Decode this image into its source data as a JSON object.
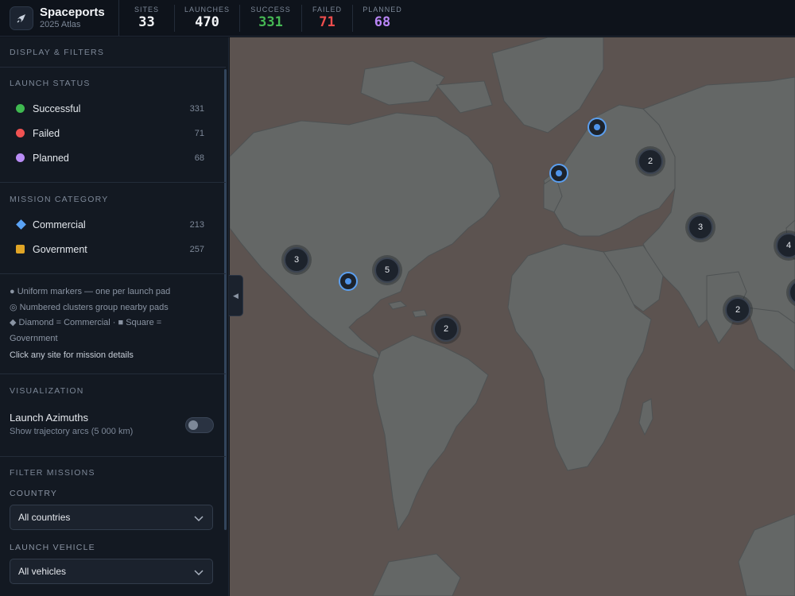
{
  "app": {
    "title": "Spaceports",
    "subtitle": "2025 Atlas",
    "logo_icon": "rocket-icon"
  },
  "stats": [
    {
      "label": "SITES",
      "value": "33",
      "color": "#f3f5f8"
    },
    {
      "label": "LAUNCHES",
      "value": "470",
      "color": "#f3f5f8"
    },
    {
      "label": "SUCCESS",
      "value": "331",
      "color": "#46b854"
    },
    {
      "label": "FAILED",
      "value": "71",
      "color": "#ec4d4d"
    },
    {
      "label": "PLANNED",
      "value": "68",
      "color": "#b985f5"
    }
  ],
  "sidebar": {
    "header": "DISPLAY & FILTERS",
    "launch_status": {
      "title": "LAUNCH STATUS",
      "items": [
        {
          "label": "Successful",
          "count": "331",
          "color": "#3fb950"
        },
        {
          "label": "Failed",
          "count": "71",
          "color": "#f05252"
        },
        {
          "label": "Planned",
          "count": "68",
          "color": "#b98cf5"
        }
      ]
    },
    "mission_category": {
      "title": "MISSION CATEGORY",
      "items": [
        {
          "label": "Commercial",
          "count": "213",
          "color": "#5aa3f5",
          "shape": "diamond"
        },
        {
          "label": "Government",
          "count": "257",
          "color": "#e0a526",
          "shape": "square"
        }
      ]
    },
    "notes": {
      "line1": "● Uniform markers — one per launch pad",
      "line2": "◎ Numbered clusters group nearby pads",
      "line3": "◆ Diamond = Commercial · ■ Square = Government",
      "hint": "Click any site for mission details"
    },
    "visualization": {
      "title": "VISUALIZATION",
      "toggle_label": "Launch Azimuths",
      "toggle_sub": "Show trajectory arcs (5 000 km)",
      "toggle_on": false
    },
    "filters": {
      "title": "FILTER MISSIONS",
      "country_label": "COUNTRY",
      "country_value": "All countries",
      "vehicle_label": "LAUNCH VEHICLE",
      "vehicle_value": "All vehicles"
    }
  },
  "map": {
    "clusters": [
      {
        "count": "3"
      },
      {
        "count": "5"
      },
      {
        "count": "2"
      },
      {
        "count": "2"
      },
      {
        "count": "3"
      },
      {
        "count": "4"
      },
      {
        "count": "2"
      }
    ],
    "pads": 3
  }
}
